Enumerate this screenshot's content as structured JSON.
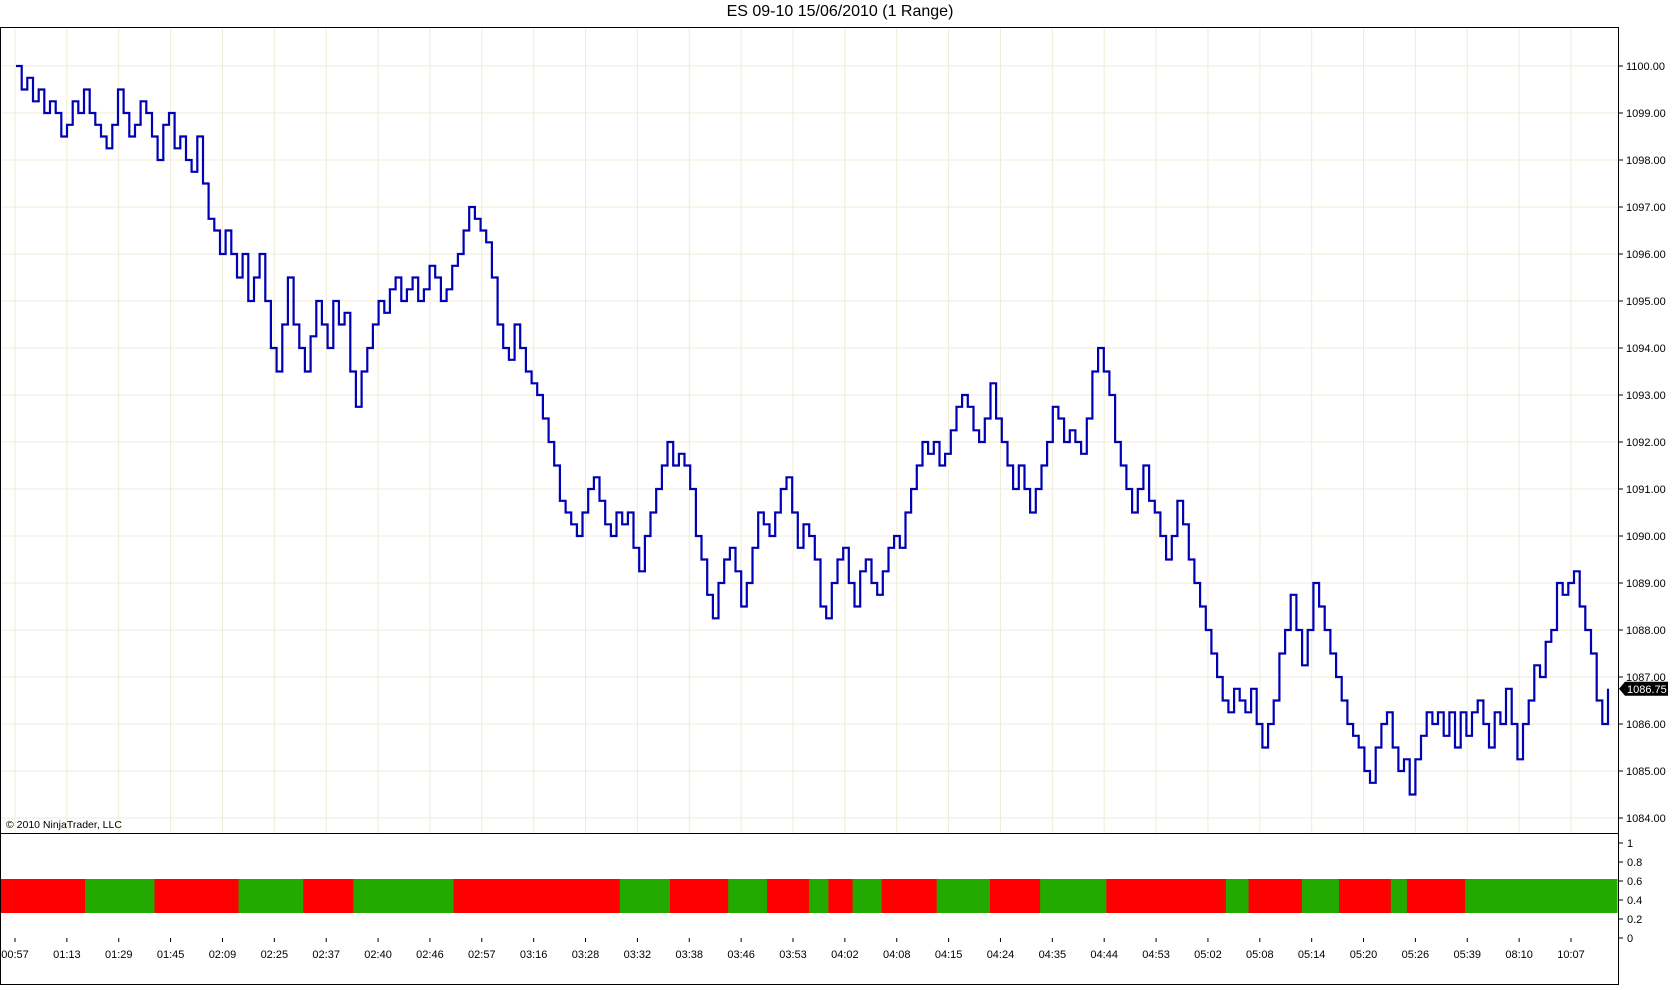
{
  "chart_title": "ES 09-10  15/06/2010 (1 Range)",
  "copyright": "© 2010 NinjaTrader, LLC",
  "colors": {
    "price_line": "#0000b4",
    "indicator_up": "#22aa00",
    "indicator_down": "#ff0000",
    "last_price_bg": "#000000",
    "grid": "#f0ecd8"
  },
  "chart_data": [
    {
      "type": "line",
      "title": "ES 09-10  15/06/2010 (1 Range)",
      "y_ticks": [
        "1100.00",
        "1099.00",
        "1098.00",
        "1097.00",
        "1096.00",
        "1095.00",
        "1094.00",
        "1093.00",
        "1092.00",
        "1091.00",
        "1090.00",
        "1089.00",
        "1088.00",
        "1087.00",
        "1086.00",
        "1085.00",
        "1084.00"
      ],
      "ylim": [
        1083.7,
        1100.85
      ],
      "last_price": "1086.75",
      "x_labels": [
        "00:57",
        "01:13",
        "01:29",
        "01:45",
        "02:09",
        "02:25",
        "02:37",
        "02:40",
        "02:46",
        "02:57",
        "03:16",
        "03:28",
        "03:32",
        "03:38",
        "03:46",
        "03:53",
        "04:02",
        "04:08",
        "04:15",
        "04:24",
        "04:35",
        "04:44",
        "04:53",
        "05:02",
        "05:08",
        "05:14",
        "05:20",
        "05:26",
        "05:39",
        "08:10",
        "10:07"
      ],
      "series": [
        {
          "values": [
            1100.0,
            1099.5,
            1099.75,
            1099.25,
            1099.5,
            1099.0,
            1099.25,
            1099.0,
            1098.5,
            1098.75,
            1099.25,
            1099.0,
            1099.5,
            1099.0,
            1098.75,
            1098.5,
            1098.25,
            1098.75,
            1099.5,
            1099.0,
            1098.5,
            1098.75,
            1099.25,
            1099.0,
            1098.5,
            1098.0,
            1098.75,
            1099.0,
            1098.25,
            1098.5,
            1098.0,
            1097.75,
            1098.5,
            1097.5,
            1096.75,
            1096.5,
            1096.0,
            1096.5,
            1096.0,
            1095.5,
            1096.0,
            1095.0,
            1095.5,
            1096.0,
            1095.0,
            1094.0,
            1093.5,
            1094.5,
            1095.5,
            1094.5,
            1094.0,
            1093.5,
            1094.25,
            1095.0,
            1094.5,
            1094.0,
            1095.0,
            1094.5,
            1094.75,
            1093.5,
            1092.75,
            1093.5,
            1094.0,
            1094.5,
            1095.0,
            1094.75,
            1095.25,
            1095.5,
            1095.0,
            1095.25,
            1095.5,
            1095.0,
            1095.25,
            1095.75,
            1095.5,
            1095.0,
            1095.25,
            1095.75,
            1096.0,
            1096.5,
            1097.0,
            1096.75,
            1096.5,
            1096.25,
            1095.5,
            1094.5,
            1094.0,
            1093.75,
            1094.5,
            1094.0,
            1093.5,
            1093.25,
            1093.0,
            1092.5,
            1092.0,
            1091.5,
            1090.75,
            1090.5,
            1090.25,
            1090.0,
            1090.5,
            1091.0,
            1091.25,
            1090.75,
            1090.25,
            1090.0,
            1090.5,
            1090.25,
            1090.5,
            1089.75,
            1089.25,
            1090.0,
            1090.5,
            1091.0,
            1091.5,
            1092.0,
            1091.5,
            1091.75,
            1091.5,
            1091.0,
            1090.0,
            1089.5,
            1088.75,
            1088.25,
            1089.0,
            1089.5,
            1089.75,
            1089.25,
            1088.5,
            1089.0,
            1089.75,
            1090.5,
            1090.25,
            1090.0,
            1090.5,
            1091.0,
            1091.25,
            1090.5,
            1089.75,
            1090.25,
            1090.0,
            1089.5,
            1088.5,
            1088.25,
            1089.0,
            1089.5,
            1089.75,
            1089.0,
            1088.5,
            1089.25,
            1089.5,
            1089.0,
            1088.75,
            1089.25,
            1089.75,
            1090.0,
            1089.75,
            1090.5,
            1091.0,
            1091.5,
            1092.0,
            1091.75,
            1092.0,
            1091.5,
            1091.75,
            1092.25,
            1092.75,
            1093.0,
            1092.75,
            1092.25,
            1092.0,
            1092.5,
            1093.25,
            1092.5,
            1092.0,
            1091.5,
            1091.0,
            1091.5,
            1091.0,
            1090.5,
            1091.0,
            1091.5,
            1092.0,
            1092.75,
            1092.5,
            1092.0,
            1092.25,
            1092.0,
            1091.75,
            1092.5,
            1093.5,
            1094.0,
            1093.5,
            1093.0,
            1092.0,
            1091.5,
            1091.0,
            1090.5,
            1091.0,
            1091.5,
            1090.75,
            1090.5,
            1090.0,
            1089.5,
            1090.0,
            1090.75,
            1090.25,
            1089.5,
            1089.0,
            1088.5,
            1088.0,
            1087.5,
            1087.0,
            1086.5,
            1086.25,
            1086.75,
            1086.5,
            1086.25,
            1086.75,
            1086.0,
            1085.5,
            1086.0,
            1086.5,
            1087.5,
            1088.0,
            1088.75,
            1088.0,
            1087.25,
            1088.0,
            1089.0,
            1088.5,
            1088.0,
            1087.5,
            1087.0,
            1086.5,
            1086.0,
            1085.75,
            1085.5,
            1085.0,
            1084.75,
            1085.5,
            1086.0,
            1086.25,
            1085.5,
            1085.0,
            1085.25,
            1084.5,
            1085.25,
            1085.75,
            1086.25,
            1086.0,
            1086.25,
            1085.75,
            1086.25,
            1085.5,
            1086.25,
            1085.75,
            1086.25,
            1086.5,
            1086.0,
            1085.5,
            1086.25,
            1086.0,
            1086.75,
            1086.0,
            1085.25,
            1086.0,
            1086.5,
            1087.25,
            1087.0,
            1087.75,
            1088.0,
            1089.0,
            1088.75,
            1089.0,
            1089.25,
            1088.5,
            1088.0,
            1087.5,
            1086.5,
            1086.0,
            1086.75
          ]
        }
      ]
    },
    {
      "type": "heatmap",
      "y_ticks": [
        "1",
        "0.8",
        "0.6",
        "0.4",
        "0.2",
        "0"
      ],
      "ylim": [
        0,
        1
      ],
      "segments": [
        {
          "state": "down",
          "start": 0.0,
          "end": 0.052
        },
        {
          "state": "up",
          "start": 0.052,
          "end": 0.095
        },
        {
          "state": "down",
          "start": 0.095,
          "end": 0.147
        },
        {
          "state": "up",
          "start": 0.147,
          "end": 0.187
        },
        {
          "state": "down",
          "start": 0.187,
          "end": 0.218
        },
        {
          "state": "up",
          "start": 0.218,
          "end": 0.28
        },
        {
          "state": "down",
          "start": 0.28,
          "end": 0.383
        },
        {
          "state": "up",
          "start": 0.383,
          "end": 0.414
        },
        {
          "state": "down",
          "start": 0.414,
          "end": 0.45
        },
        {
          "state": "up",
          "start": 0.45,
          "end": 0.474
        },
        {
          "state": "down",
          "start": 0.474,
          "end": 0.5
        },
        {
          "state": "up",
          "start": 0.5,
          "end": 0.512
        },
        {
          "state": "down",
          "start": 0.512,
          "end": 0.527
        },
        {
          "state": "up",
          "start": 0.527,
          "end": 0.545
        },
        {
          "state": "down",
          "start": 0.545,
          "end": 0.579
        },
        {
          "state": "up",
          "start": 0.579,
          "end": 0.612
        },
        {
          "state": "down",
          "start": 0.612,
          "end": 0.643
        },
        {
          "state": "up",
          "start": 0.643,
          "end": 0.684
        },
        {
          "state": "down",
          "start": 0.684,
          "end": 0.758
        },
        {
          "state": "up",
          "start": 0.758,
          "end": 0.772
        },
        {
          "state": "down",
          "start": 0.772,
          "end": 0.805
        },
        {
          "state": "up",
          "start": 0.805,
          "end": 0.828
        },
        {
          "state": "down",
          "start": 0.828,
          "end": 0.86
        },
        {
          "state": "up",
          "start": 0.86,
          "end": 0.87
        },
        {
          "state": "down",
          "start": 0.87,
          "end": 0.906
        },
        {
          "state": "up",
          "start": 0.906,
          "end": 1.0
        }
      ]
    }
  ]
}
